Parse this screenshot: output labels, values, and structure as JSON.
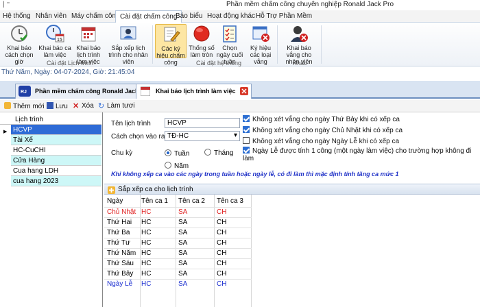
{
  "window": {
    "title": "Phần mềm chấm công chuyên nghiệp Ronald Jack Pro",
    "quick_access": "|  ⁼"
  },
  "menu": [
    "Hệ thống",
    "Nhân viên",
    "Máy chấm công",
    "Cài đặt chấm công",
    "Báo biểu",
    "Hoạt động khác",
    "Hỗ Trợ Phần Mềm"
  ],
  "ribbon": {
    "buttons": [
      {
        "label": "Khai báo cách chọn giờ",
        "icon": "clock-check-icon"
      },
      {
        "label": "Khai báo ca làm việc",
        "icon": "clock-calendar-icon"
      },
      {
        "label": "Khai báo lịch trình làm việc",
        "icon": "calendar-icon"
      },
      {
        "label": "Sắp xếp lịch trình cho nhân viên",
        "icon": "schedule-user-icon"
      },
      {
        "label": "Các ký hiệu chấm công",
        "icon": "notepad-pencil-icon"
      },
      {
        "label": "Thống số làm tròn",
        "icon": "red-circle-icon"
      },
      {
        "label": "Chọn ngày cuối tuần",
        "icon": "checklist-icon"
      },
      {
        "label": "Ký hiệu các loại vắng",
        "icon": "window-x-icon"
      },
      {
        "label": "Khai báo vắng cho nhân viên",
        "icon": "user-x-icon"
      }
    ],
    "groups": [
      "Cài đặt Lịch trình",
      "Cài đặt hệ thống",
      "Khác"
    ]
  },
  "datebar": "Thứ Năm, Ngày: 04-07-2024, Giờ: 21:45:04",
  "doc_tabs": [
    "Phần mềm chấm công Ronald Jack Pro",
    "Khai báo lịch trình làm việc"
  ],
  "toolbar": [
    "Thêm mới",
    "Lưu",
    "Xóa",
    "Làm tươi"
  ],
  "schedule_list": {
    "header": "Lịch trình",
    "items": [
      "HCVP",
      "Tài Xế",
      "HC-CuCHI",
      "Cửa Hàng",
      "Cua hang LDH",
      "cua hang 2023"
    ],
    "selected": "HCVP"
  },
  "form": {
    "name_label": "Tên lịch trình",
    "name_value": "HCVP",
    "inout_label": "Cách chọn vào ra",
    "inout_value": "TĐ-HC",
    "cycle_label": "Chu kỳ",
    "cycle_options": [
      "Tuần",
      "Tháng",
      "Năm"
    ],
    "cycle_selected": "Tuần",
    "checkboxes": [
      {
        "label": "Không xét vắng cho ngày Thứ Bảy khi có xếp ca",
        "checked": true
      },
      {
        "label": "Không xét vắng cho ngày Chủ Nhật khi có xếp ca",
        "checked": true
      },
      {
        "label": "Không xét vắng cho ngày Ngày Lễ khi có xếp ca",
        "checked": false
      },
      {
        "label": "Ngày Lễ được tính 1 công (một ngày làm việc) cho trường hợp không đi làm",
        "checked": true
      }
    ],
    "note": "Khi không xếp ca vào các ngày trong tuần hoặc ngày lễ, có đi làm thì mặc định tính tăng ca mức 1"
  },
  "grid": {
    "title": "Sắp xếp ca cho lịch trình",
    "columns": [
      "Ngày",
      "Tên ca 1",
      "Tên ca 2",
      "Tên ca 3"
    ],
    "rows": [
      {
        "day": "Chủ Nhật",
        "c1": "HC",
        "c2": "SA",
        "c3": "CH",
        "color": "#e02020"
      },
      {
        "day": "Thứ Hai",
        "c1": "HC",
        "c2": "SA",
        "c3": "CH",
        "color": "#000000"
      },
      {
        "day": "Thứ Ba",
        "c1": "HC",
        "c2": "SA",
        "c3": "CH",
        "color": "#000000"
      },
      {
        "day": "Thứ Tư",
        "c1": "HC",
        "c2": "SA",
        "c3": "CH",
        "color": "#000000"
      },
      {
        "day": "Thứ Năm",
        "c1": "HC",
        "c2": "SA",
        "c3": "CH",
        "color": "#000000"
      },
      {
        "day": "Thứ Sáu",
        "c1": "HC",
        "c2": "SA",
        "c3": "CH",
        "color": "#000000"
      },
      {
        "day": "Thứ Bảy",
        "c1": "HC",
        "c2": "SA",
        "c3": "CH",
        "color": "#000000"
      },
      {
        "day": "Ngày Lễ",
        "c1": "HC",
        "c2": "SA",
        "c3": "CH",
        "color": "#1c2fd0"
      }
    ]
  }
}
